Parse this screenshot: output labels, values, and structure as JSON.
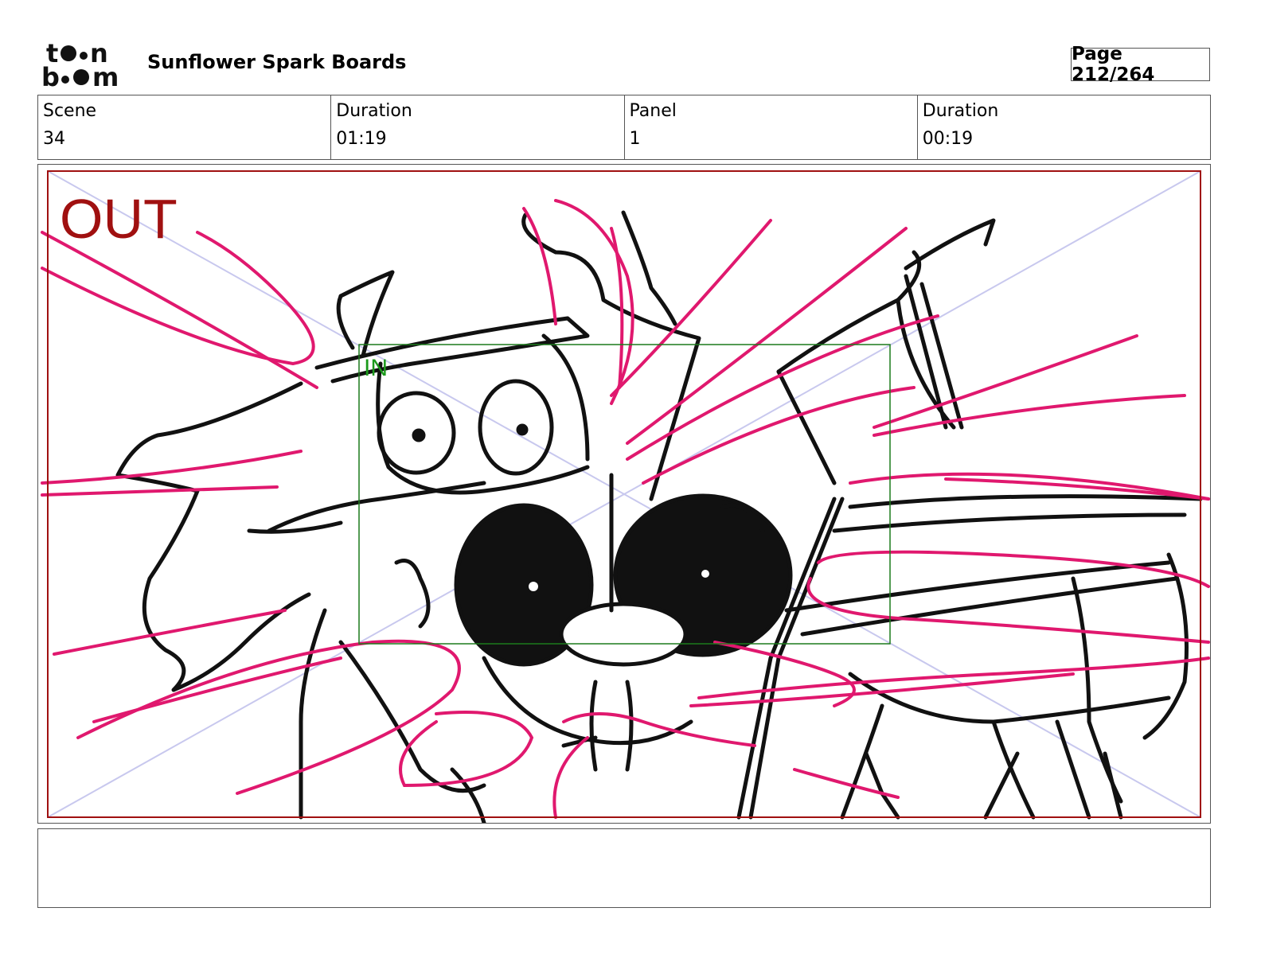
{
  "header": {
    "logo_text": "toonboom",
    "project_title": "Sunflower Spark Boards",
    "page_label": "Page 212/264"
  },
  "info": {
    "scene_label": "Scene",
    "scene_value": "34",
    "scene_duration_label": "Duration",
    "scene_duration_value": "01:19",
    "panel_label": "Panel",
    "panel_value": "1",
    "panel_duration_label": "Duration",
    "panel_duration_value": "00:19"
  },
  "panel": {
    "out_label": "OUT",
    "in_label": "IN"
  },
  "notes": {
    "text": ""
  },
  "colors": {
    "out_frame": "#a01010",
    "in_frame": "#1c7a1c",
    "action_lines": "#e0186e",
    "guides": "#c8c8ee"
  }
}
